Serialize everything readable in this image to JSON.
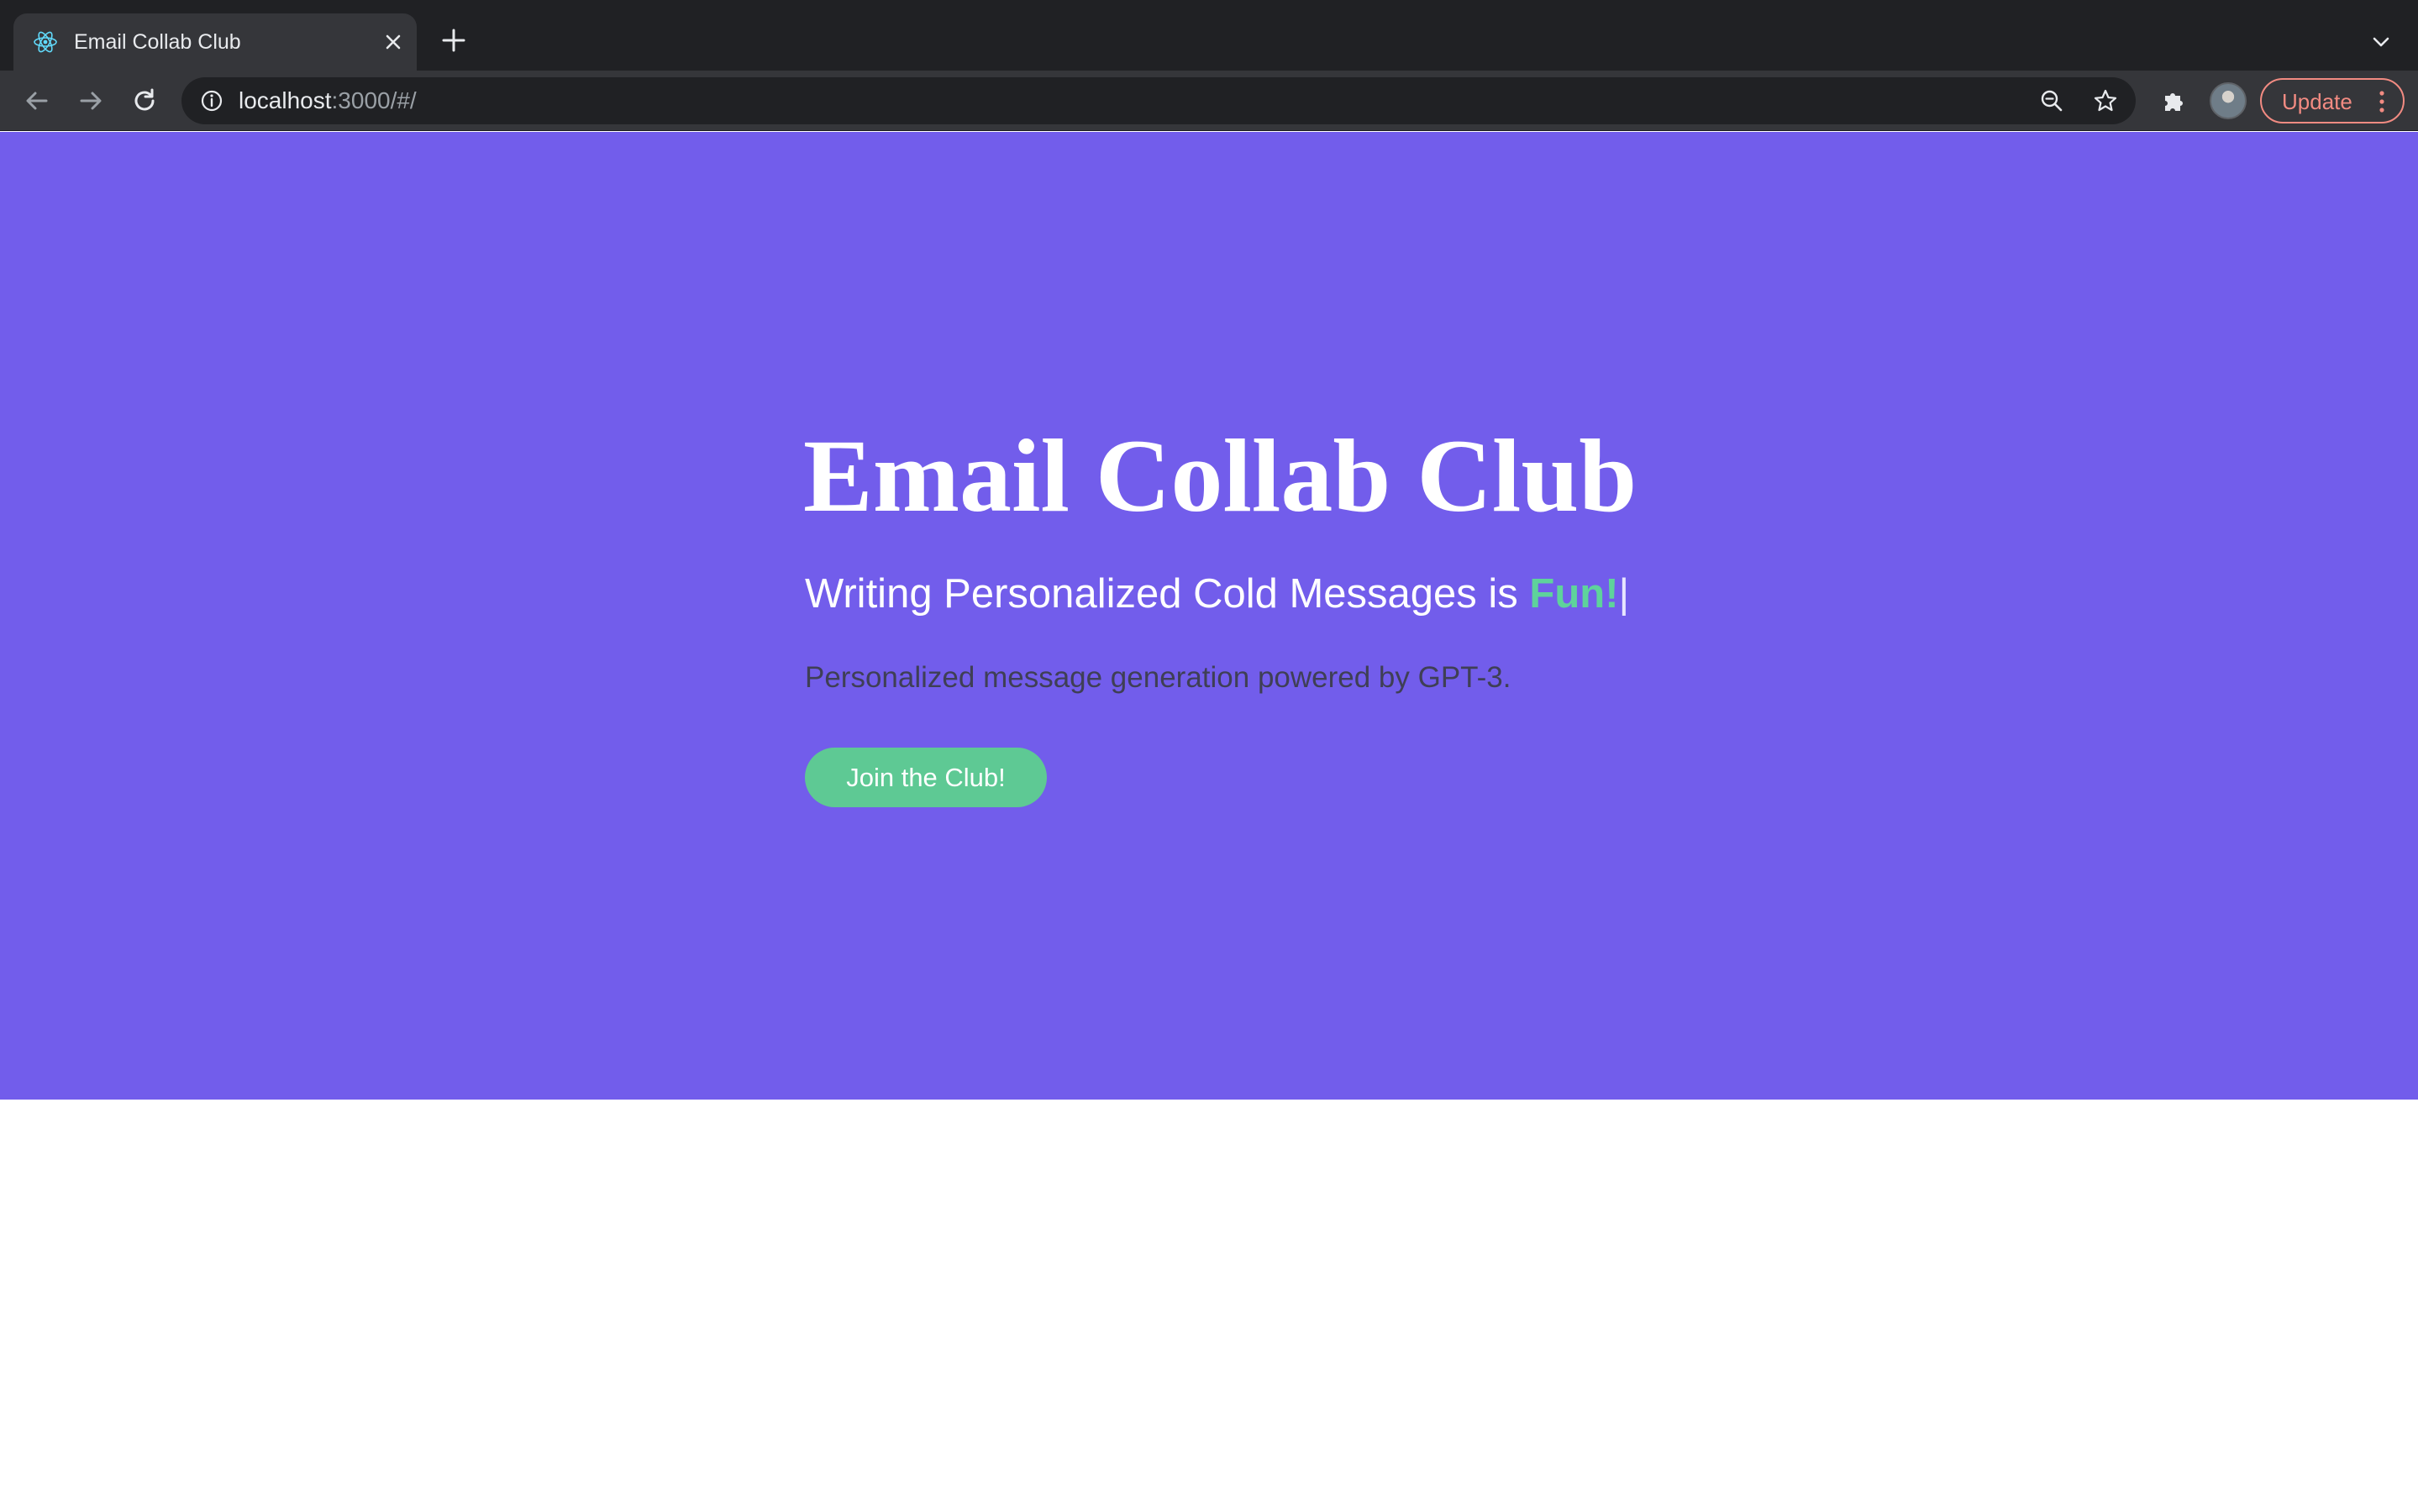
{
  "browser": {
    "tab": {
      "title": "Email Collab Club",
      "favicon": "react-atom-icon"
    },
    "url": {
      "host": "localhost",
      "path": ":3000/#/"
    },
    "update_label": "Update",
    "colors": {
      "tabbar": "#202124",
      "toolbar": "#35363a",
      "update_accent": "#f28b82"
    }
  },
  "hero": {
    "title": "Email Collab Club",
    "subtitle_prefix": "Writing Personalized Cold Messages is ",
    "subtitle_highlight": "Fun!",
    "subtitle_cursor": "|",
    "description": "Personalized message generation powered by GPT-3.",
    "cta_label": "Join the Club!",
    "colors": {
      "background": "#725deb",
      "accent": "#5ed39b",
      "button": "#5ec994"
    }
  }
}
